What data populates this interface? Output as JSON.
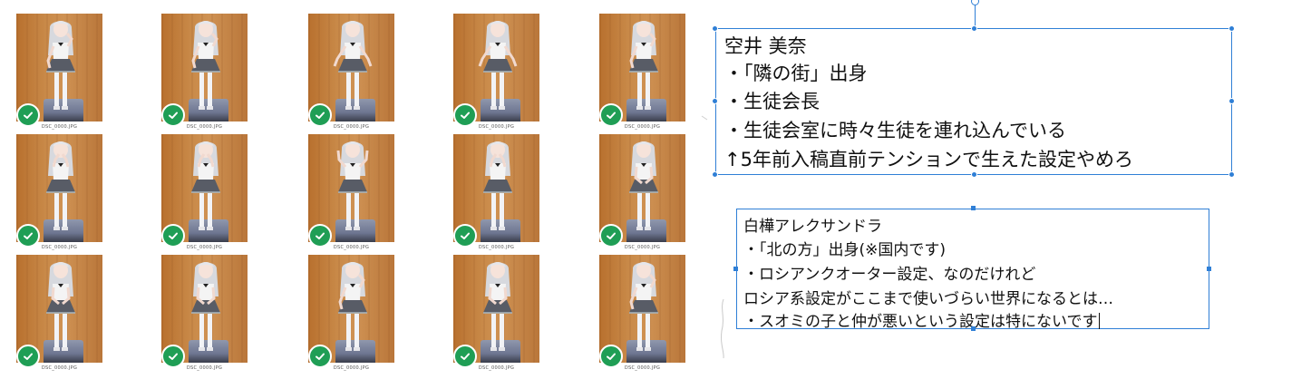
{
  "photo_grid": {
    "thumbnails": [
      {
        "filename": "DSC_0000.JPG",
        "pose": "hand-up",
        "selected": true
      },
      {
        "filename": "DSC_0000.JPG",
        "pose": "hand-up",
        "selected": true
      },
      {
        "filename": "DSC_0000.JPG",
        "pose": "arms-out",
        "selected": true
      },
      {
        "filename": "DSC_0000.JPG",
        "pose": "arms-out",
        "selected": true
      },
      {
        "filename": "DSC_0000.JPG",
        "pose": "hand-up",
        "selected": true
      },
      {
        "filename": "DSC_0000.JPG",
        "pose": "hands-face",
        "selected": true
      },
      {
        "filename": "DSC_0000.JPG",
        "pose": "hands-face",
        "selected": true
      },
      {
        "filename": "DSC_0000.JPG",
        "pose": "hands-up",
        "selected": true
      },
      {
        "filename": "DSC_0000.JPG",
        "pose": "hands-face",
        "selected": true
      },
      {
        "filename": "DSC_0000.JPG",
        "pose": "hands-front",
        "selected": true
      },
      {
        "filename": "DSC_0000.JPG",
        "pose": "hands-front",
        "selected": true
      },
      {
        "filename": "DSC_0000.JPG",
        "pose": "hands-front",
        "selected": true
      },
      {
        "filename": "DSC_0000.JPG",
        "pose": "hand-up",
        "selected": true
      },
      {
        "filename": "DSC_0000.JPG",
        "pose": "hands-front",
        "selected": true
      },
      {
        "filename": "DSC_0000.JPG",
        "pose": "hand-up",
        "selected": true
      }
    ],
    "check_icon": "checkmark-icon",
    "check_color": "#1f9e55",
    "backdrop_color": "#c98a49"
  },
  "text_box_1": {
    "lines": [
      "空井 美奈",
      "・「隣の街」出身",
      "・生徒会長",
      "・生徒会室に時々生徒を連れ込んでいる",
      "↑5年前入稿直前テンションで生えた設定やめろ"
    ]
  },
  "text_box_2": {
    "lines": [
      "白樺アレクサンドラ",
      "・「北の方」出身(※国内です)",
      "・ロシアンクオーター設定、なのだけれど",
      "ロシア系設定がここまで使いづらい世界になるとは…",
      "・スオミの子と仲が悪いという設定は特にないです"
    ]
  },
  "selection_color": "#2f7fd6"
}
